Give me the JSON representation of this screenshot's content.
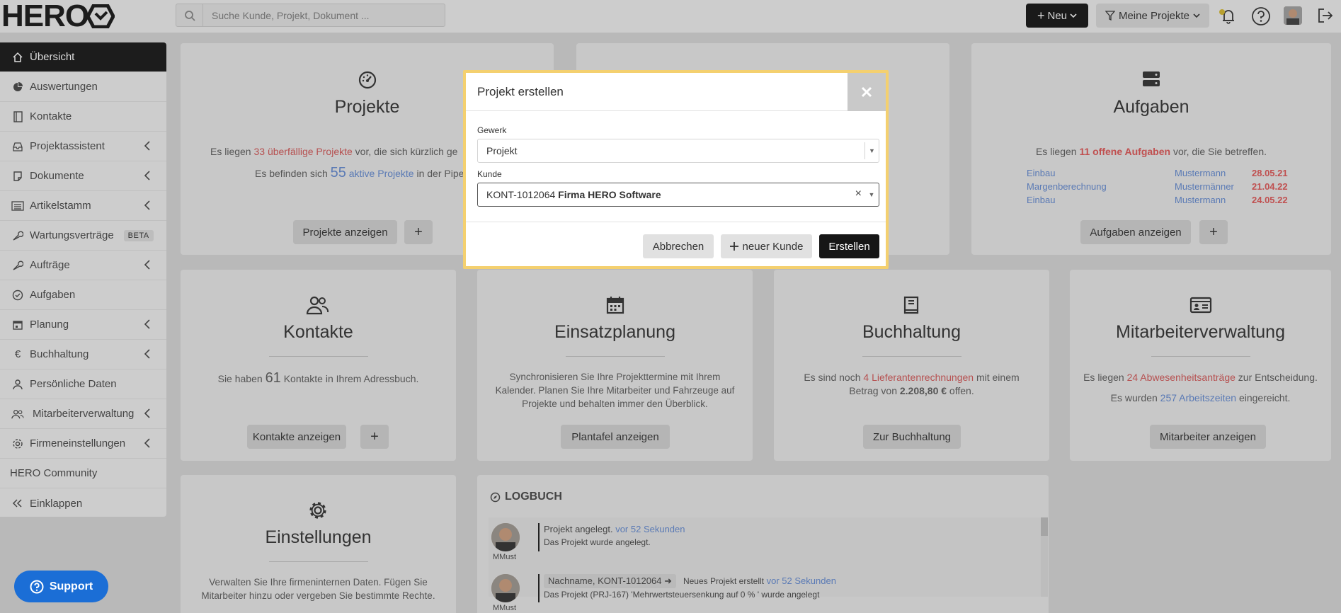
{
  "brand": {
    "logo_text": "HERO"
  },
  "search": {
    "placeholder": "Suche Kunde, Projekt, Dokument ..."
  },
  "topbar": {
    "new_label": "Neu",
    "filter_label": "Meine Projekte"
  },
  "sidebar": {
    "items": [
      {
        "label": "Übersicht",
        "icon": "home-icon"
      },
      {
        "label": "Auswertungen",
        "icon": "pie-chart-icon"
      },
      {
        "label": "Kontakte",
        "icon": "address-book-icon"
      },
      {
        "label": "Projektassistent",
        "icon": "inbox-icon"
      },
      {
        "label": "Dokumente",
        "icon": "document-icon"
      },
      {
        "label": "Artikelstamm",
        "icon": "list-icon"
      },
      {
        "label": "Wartungsverträge",
        "icon": "wrench-icon",
        "badge": "BETA"
      },
      {
        "label": "Aufträge",
        "icon": "wrench-icon"
      },
      {
        "label": "Aufgaben",
        "icon": "check-circle-icon"
      },
      {
        "label": "Planung",
        "icon": "calendar-icon"
      },
      {
        "label": "Buchhaltung",
        "icon": "euro-icon"
      },
      {
        "label": "Persönliche Daten",
        "icon": "user-icon"
      },
      {
        "label": "Mitarbeiterverwaltung",
        "icon": "users-icon"
      },
      {
        "label": "Firmeneinstellungen",
        "icon": "gear-icon"
      },
      {
        "label": "HERO Community",
        "icon": ""
      },
      {
        "label": "Einklappen",
        "icon": "double-chevron-left-icon"
      }
    ]
  },
  "cards": {
    "projekte": {
      "title": "Projekte",
      "line1_pre": "Es liegen ",
      "line1_hl": "33 überfällige Projekte",
      "line1_post": " vor, die sich kürzlich ge",
      "line2_pre": "Es befinden sich ",
      "line2_num": "55",
      "line2_hl": " aktive Projekte",
      "line2_post": " in der Pipe",
      "btn": "Projekte anzeigen",
      "plus": "+"
    },
    "aufgaben": {
      "title": "Aufgaben",
      "line_pre": "Es liegen ",
      "line_hl": "11 offene Aufgaben",
      "line_post": " vor, die Sie betreffen.",
      "tasks": [
        {
          "name": "Einbau",
          "person": "Mustermann",
          "date": "28.05.21"
        },
        {
          "name": "Margenberechnung",
          "person": "Mustermänner",
          "date": "21.04.22"
        },
        {
          "name": "Einbau",
          "person": "Mustermann",
          "date": "24.05.22"
        }
      ],
      "btn": "Aufgaben anzeigen",
      "plus": "+"
    },
    "kontakte": {
      "title": "Kontakte",
      "line_pre": "Sie haben ",
      "line_num": "61",
      "line_post": " Kontakte in Ihrem Adressbuch.",
      "btn": "Kontakte anzeigen",
      "plus": "+"
    },
    "einsatz": {
      "title": "Einsatzplanung",
      "text": "Synchronisieren Sie Ihre Projekttermine mit Ihrem Kalender. Planen Sie Ihre Mitarbeiter und Fahrzeuge auf Projekte und behalten immer den Überblick.",
      "btn": "Plantafel anzeigen"
    },
    "buchhaltung": {
      "title": "Buchhaltung",
      "line_pre": "Es sind noch ",
      "line_hl": "4 Lieferantenrechnungen",
      "line_mid": " mit einem Betrag von ",
      "line_amount": "2.208,80 €",
      "line_post": " offen.",
      "btn": "Zur Buchhaltung"
    },
    "mitarbeiter": {
      "title": "Mitarbeiterverwaltung",
      "line1_pre": "Es liegen ",
      "line1_hl": "24 Abwesenheitsanträge",
      "line1_post": " zur Entscheidung.",
      "line2_pre": "Es wurden ",
      "line2_hl": "257 Arbeitszeiten",
      "line2_post": " eingereicht.",
      "btn": "Mitarbeiter anzeigen"
    },
    "einstellungen": {
      "title": "Einstellungen",
      "text": "Verwalten Sie Ihre firmeninternen Daten. Fügen Sie Mitarbeiter hinzu oder vergeben Sie bestimmte Rechte."
    },
    "logbuch": {
      "title": "LOGBUCH",
      "entries": [
        {
          "user": "MMust",
          "text": "Projekt angelegt.",
          "time": "vor 52 Sekunden",
          "detail": "Das Projekt wurde angelegt."
        },
        {
          "user": "MMust",
          "chip": "Nachname, KONT-1012064",
          "text": "Neues Projekt erstellt",
          "time": "vor 52 Sekunden",
          "detail": "Das Projekt (PRJ-167) 'Mehrwertsteuersenkung auf 0 % ' wurde angelegt"
        }
      ]
    }
  },
  "support": {
    "label": "Support"
  },
  "modal": {
    "title": "Projekt erstellen",
    "gewerk_label": "Gewerk",
    "gewerk_value": "Projekt",
    "kunde_label": "Kunde",
    "kunde_id": "KONT-1012064 ",
    "kunde_name": "Firma HERO Software",
    "cancel": "Abbrechen",
    "new_customer": "neuer Kunde",
    "create": "Erstellen"
  },
  "colors": {
    "accent_red": "#c05050",
    "link_blue": "#5a7ab5",
    "modal_border": "#f4d06f",
    "support_blue": "#1b6ed6"
  }
}
